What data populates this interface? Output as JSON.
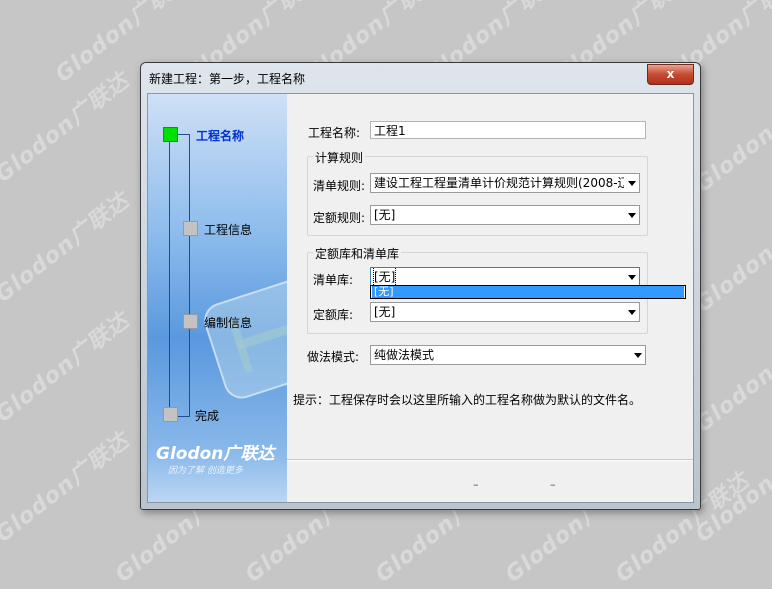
{
  "background": {
    "watermark_text": "Glodon广联达"
  },
  "window": {
    "title": "新建工程：第一步，工程名称",
    "close_label": "x"
  },
  "sidebar": {
    "steps": [
      {
        "label": "工程名称",
        "active": true
      },
      {
        "label": "工程信息",
        "active": false
      },
      {
        "label": "编制信息",
        "active": false
      },
      {
        "label": "完成",
        "active": false
      }
    ],
    "logo": "Glodon广联达",
    "slogan": "因为了解 创造更多"
  },
  "form": {
    "project_name_label": "工程名称:",
    "project_name_value": "工程1",
    "calc_rules_group": "计算规则",
    "bill_rule_label": "清单规则:",
    "bill_rule_value": "建设工程工程量清单计价规范计算规则(2008-辽",
    "quota_rule_label": "定额规则:",
    "quota_rule_value": "[无]",
    "library_group": "定额库和清单库",
    "bill_lib_label": "清单库:",
    "bill_lib_value": "[无]",
    "bill_lib_options": [
      "[无]"
    ],
    "quota_lib_label": "定额库:",
    "quota_lib_value": "[无]",
    "method_label": "做法模式:",
    "method_value": "纯做法模式",
    "hint": "提示：工程保存时会以这里所输入的工程名称做为默认的文件名。",
    "btn_a": "–",
    "btn_b": "–"
  },
  "colors": {
    "desktop": "#c6c6c6",
    "selection": "#3399ff",
    "active_step": "#00e000",
    "active_label": "#0033cc"
  }
}
